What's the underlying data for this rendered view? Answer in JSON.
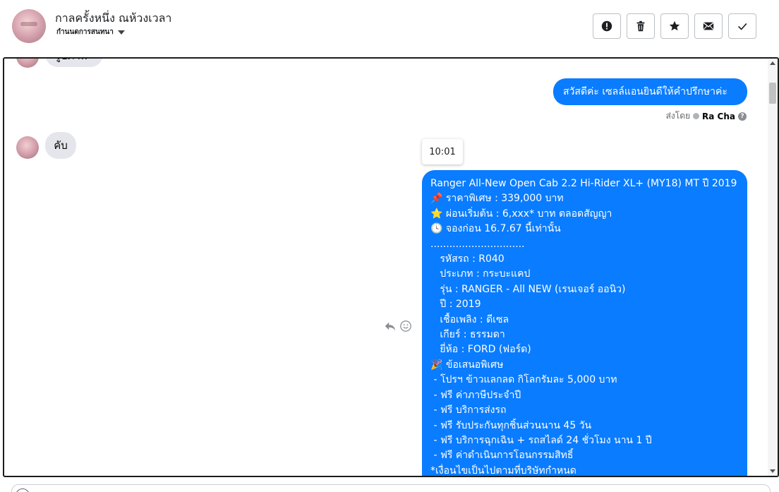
{
  "header": {
    "contact_name": "กาลครั้งหนึ่ง ณห้วงเวลา",
    "status": "กำนนดการสนทนา",
    "actions": [
      {
        "icon": "alert-icon",
        "label": "alert"
      },
      {
        "icon": "trash-icon",
        "label": "delete"
      },
      {
        "icon": "star-icon",
        "label": "star"
      },
      {
        "icon": "mail-icon",
        "label": "mail"
      },
      {
        "icon": "check-icon",
        "label": "done"
      }
    ]
  },
  "messages": {
    "top_partial": "รูปภาพ",
    "greeting_out": "สวัสดีค่ะ เซลล์แอนยินดีให้คำปรึกษาค่ะ",
    "sent_by_label": "ส่งโดย",
    "sent_by_name": "Ra Cha",
    "help_glyph": "?",
    "reply_in": "คับ",
    "timestamp": "10:01",
    "long_message": [
      "Ranger All-New Open Cab 2.2 Hi-Rider XL+ (MY18) MT ปี 2019",
      "📌 ราคาพิเศษ : 339,000 บาท",
      "⭐ ผ่อนเริ่มต้น : 6,xxx* บาท ตลอดสัญญา",
      "🕓 จองก่อน 16.7.67 นี้เท่านั้น",
      "..............................",
      "   รหัสรถ : R040",
      "   ประเภท : กระบะแคป",
      "   รุ่น : RANGER - All NEW (เรนเจอร์ ออนิว)",
      "   ปี : 2019",
      "   เชื้อเพลิง : ดีเซล",
      "   เกียร์ : ธรรมดา",
      "   ยี่ห้อ : FORD (ฟอร์ด)",
      "🎉 ข้อเสนอพิเศษ",
      " - โปรฯ ข้าวแลกลด กิโลกรัมละ 5,000 บาท",
      " - ฟรี ค่าภาษีประจำปี",
      " - ฟรี บริการส่งรถ",
      " - ฟรี รับประกันทุกชิ้นส่วนนาน 45 วัน",
      " - ฟรี บริการฉุกเฉิน + รถสไลด์ 24 ชั่วโมง นาน 1 ปี",
      " - ฟรี ค่าดำเนินการโอนกรรมสิทธิ์",
      "*เงื่อนไขเป็นไปตามที่บริษัทกำหนด"
    ]
  },
  "colors": {
    "bubble_out": "#0a7cff",
    "bubble_in": "#e4e6eb"
  }
}
